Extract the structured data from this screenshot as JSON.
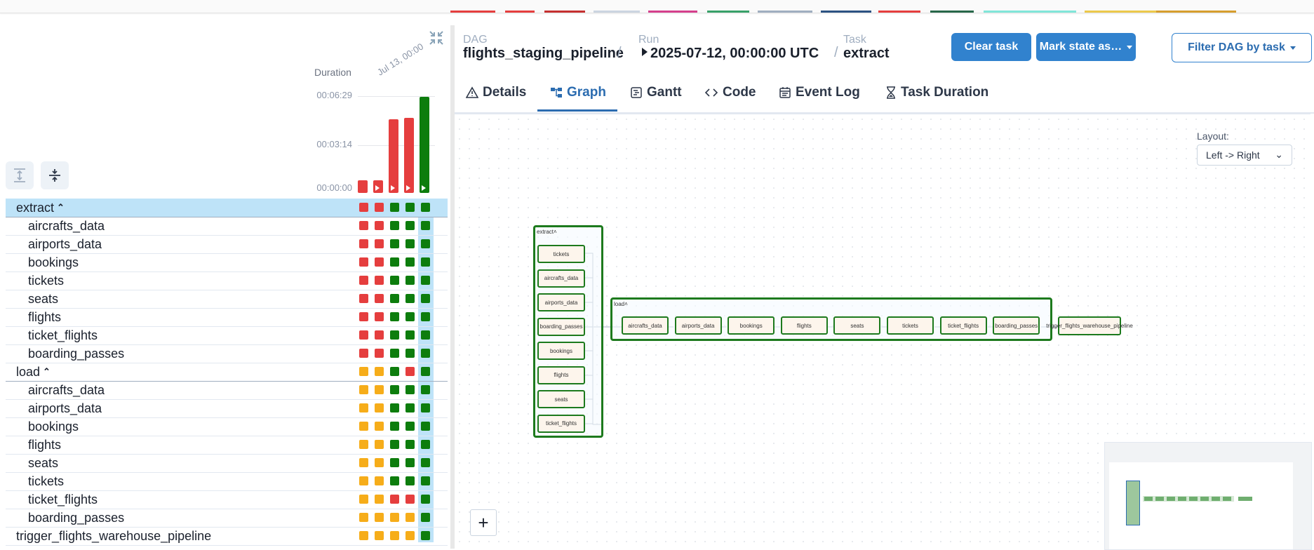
{
  "colors": {
    "failed": "#e53e3e",
    "success": "#0d7d0d",
    "upstream_failed": "#f6ad1a",
    "selected_row": "#bee3f8",
    "accent": "#3182ce"
  },
  "left_panel": {
    "duration_label": "Duration",
    "date_label": "Jul 13, 00:00",
    "y_ticks": [
      "00:06:29",
      "00:03:14",
      "00:00:00"
    ],
    "run_bars": [
      {
        "state": "failed",
        "duration_fraction": 0.13,
        "has_play": false
      },
      {
        "state": "failed",
        "duration_fraction": 0.13,
        "has_play": true
      },
      {
        "state": "failed",
        "duration_fraction": 0.77,
        "has_play": true
      },
      {
        "state": "failed",
        "duration_fraction": 0.78,
        "has_play": true
      },
      {
        "state": "success",
        "duration_fraction": 1.0,
        "has_play": true
      }
    ],
    "rows": [
      {
        "name": "extract",
        "group": true,
        "indent": 0,
        "selected": true,
        "states": [
          "failed",
          "failed",
          "success",
          "success",
          "success"
        ]
      },
      {
        "name": "aircrafts_data",
        "group": false,
        "indent": 1,
        "states": [
          "failed",
          "failed",
          "success",
          "success",
          "success"
        ]
      },
      {
        "name": "airports_data",
        "group": false,
        "indent": 1,
        "states": [
          "failed",
          "failed",
          "success",
          "success",
          "success"
        ]
      },
      {
        "name": "bookings",
        "group": false,
        "indent": 1,
        "states": [
          "failed",
          "failed",
          "success",
          "success",
          "success"
        ]
      },
      {
        "name": "tickets",
        "group": false,
        "indent": 1,
        "states": [
          "failed",
          "failed",
          "success",
          "success",
          "success"
        ]
      },
      {
        "name": "seats",
        "group": false,
        "indent": 1,
        "states": [
          "failed",
          "failed",
          "success",
          "success",
          "success"
        ]
      },
      {
        "name": "flights",
        "group": false,
        "indent": 1,
        "states": [
          "failed",
          "failed",
          "success",
          "success",
          "success"
        ]
      },
      {
        "name": "ticket_flights",
        "group": false,
        "indent": 1,
        "states": [
          "failed",
          "failed",
          "success",
          "success",
          "success"
        ]
      },
      {
        "name": "boarding_passes",
        "group": false,
        "indent": 1,
        "states": [
          "failed",
          "failed",
          "success",
          "success",
          "success"
        ]
      },
      {
        "name": "load",
        "group": true,
        "indent": 0,
        "states": [
          "upstream_failed",
          "upstream_failed",
          "success",
          "failed",
          "success"
        ]
      },
      {
        "name": "aircrafts_data",
        "group": false,
        "indent": 1,
        "states": [
          "upstream_failed",
          "upstream_failed",
          "success",
          "success",
          "success"
        ]
      },
      {
        "name": "airports_data",
        "group": false,
        "indent": 1,
        "states": [
          "upstream_failed",
          "upstream_failed",
          "success",
          "success",
          "success"
        ]
      },
      {
        "name": "bookings",
        "group": false,
        "indent": 1,
        "states": [
          "upstream_failed",
          "upstream_failed",
          "success",
          "success",
          "success"
        ]
      },
      {
        "name": "flights",
        "group": false,
        "indent": 1,
        "states": [
          "upstream_failed",
          "upstream_failed",
          "success",
          "success",
          "success"
        ]
      },
      {
        "name": "seats",
        "group": false,
        "indent": 1,
        "states": [
          "upstream_failed",
          "upstream_failed",
          "success",
          "success",
          "success"
        ]
      },
      {
        "name": "tickets",
        "group": false,
        "indent": 1,
        "states": [
          "upstream_failed",
          "upstream_failed",
          "success",
          "success",
          "success"
        ]
      },
      {
        "name": "ticket_flights",
        "group": false,
        "indent": 1,
        "states": [
          "upstream_failed",
          "upstream_failed",
          "failed",
          "failed",
          "success"
        ]
      },
      {
        "name": "boarding_passes",
        "group": false,
        "indent": 1,
        "states": [
          "upstream_failed",
          "upstream_failed",
          "upstream_failed",
          "upstream_failed",
          "success"
        ]
      },
      {
        "name": "trigger_flights_warehouse_pipeline",
        "group": false,
        "indent": 0,
        "states": [
          "upstream_failed",
          "upstream_failed",
          "upstream_failed",
          "upstream_failed",
          "success"
        ]
      }
    ]
  },
  "header": {
    "dag_label": "DAG",
    "dag_value": "flights_staging_pipeline",
    "run_label": "Run",
    "run_value": "2025-07-12, 00:00:00 UTC",
    "task_label": "Task",
    "task_value": "extract",
    "separator": "/",
    "clear_task": "Clear task",
    "mark_state": "Mark state as…",
    "filter_dag": "Filter DAG by task"
  },
  "tabs": [
    {
      "label": "Details",
      "icon": "warning-triangle-icon"
    },
    {
      "label": "Graph",
      "icon": "graph-icon",
      "active": true
    },
    {
      "label": "Gantt",
      "icon": "gantt-icon"
    },
    {
      "label": "Code",
      "icon": "code-icon"
    },
    {
      "label": "Event Log",
      "icon": "calendar-icon"
    },
    {
      "label": "Task Duration",
      "icon": "hourglass-icon"
    }
  ],
  "graph": {
    "layout_label": "Layout:",
    "layout_value": "Left -> Right",
    "extract_group_label": "extract",
    "load_group_label": "load",
    "extract_nodes": [
      "tickets",
      "aircrafts_data",
      "airports_data",
      "boarding_passes",
      "bookings",
      "flights",
      "seats",
      "ticket_flights"
    ],
    "load_nodes": [
      "aircrafts_data",
      "airports_data",
      "bookings",
      "flights",
      "seats",
      "tickets",
      "ticket_flights",
      "boarding_passes"
    ],
    "trigger_node": "trigger_flights_warehouse_pipeline",
    "zoom_in": "+"
  }
}
